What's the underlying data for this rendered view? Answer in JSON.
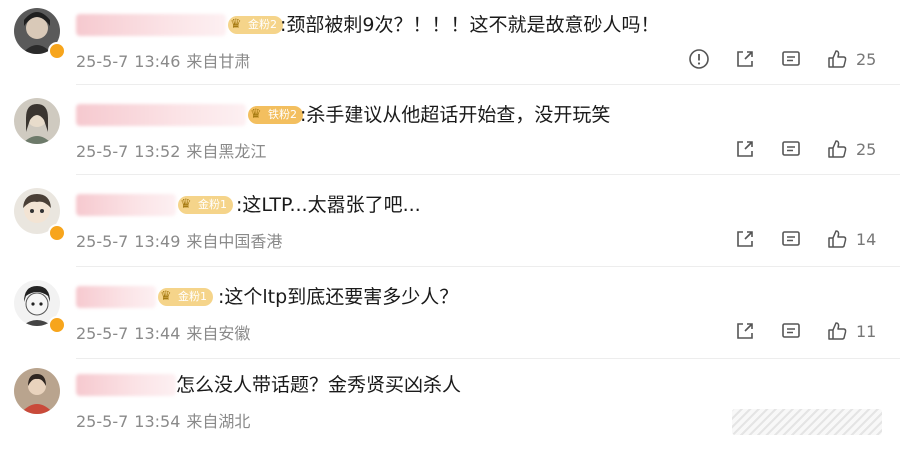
{
  "comments": [
    {
      "fan_badge": "金粉2",
      "text": ":颈部被刺9次？！！！这不就是故意砂人吗！",
      "date": "25-5-7",
      "time": "13:46",
      "location": "来自甘肃",
      "likes": "25",
      "has_report": true
    },
    {
      "fan_badge": "铁粉2",
      "text": ":杀手建议从他超话开始查，没开玩笑",
      "date": "25-5-7",
      "time": "13:52",
      "location": "来自黑龙江",
      "likes": "25",
      "has_report": false
    },
    {
      "fan_badge": "金粉1",
      "text": ":这LTP...太嚣张了吧...",
      "date": "25-5-7",
      "time": "13:49",
      "location": "来自中国香港",
      "likes": "14",
      "has_report": false
    },
    {
      "fan_badge": "金粉1",
      "text": ":这个ltp到底还要害多少人？",
      "date": "25-5-7",
      "time": "13:44",
      "location": "来自安徽",
      "likes": "11",
      "has_report": false
    },
    {
      "fan_badge": "",
      "text": "怎么没人带话题？金秀贤买凶杀人",
      "date": "25-5-7",
      "time": "13:54",
      "location": "来自湖北",
      "likes": "",
      "has_report": false
    }
  ],
  "icons": {
    "report": "report-icon",
    "share": "share-icon",
    "comment": "comment-icon",
    "like": "thumbs-up-icon"
  },
  "colors": {
    "text": "#1a1a1a",
    "meta": "#8a8a8a",
    "verified_badge": "#f7a51c",
    "fan_badge": "#f5d48a"
  }
}
